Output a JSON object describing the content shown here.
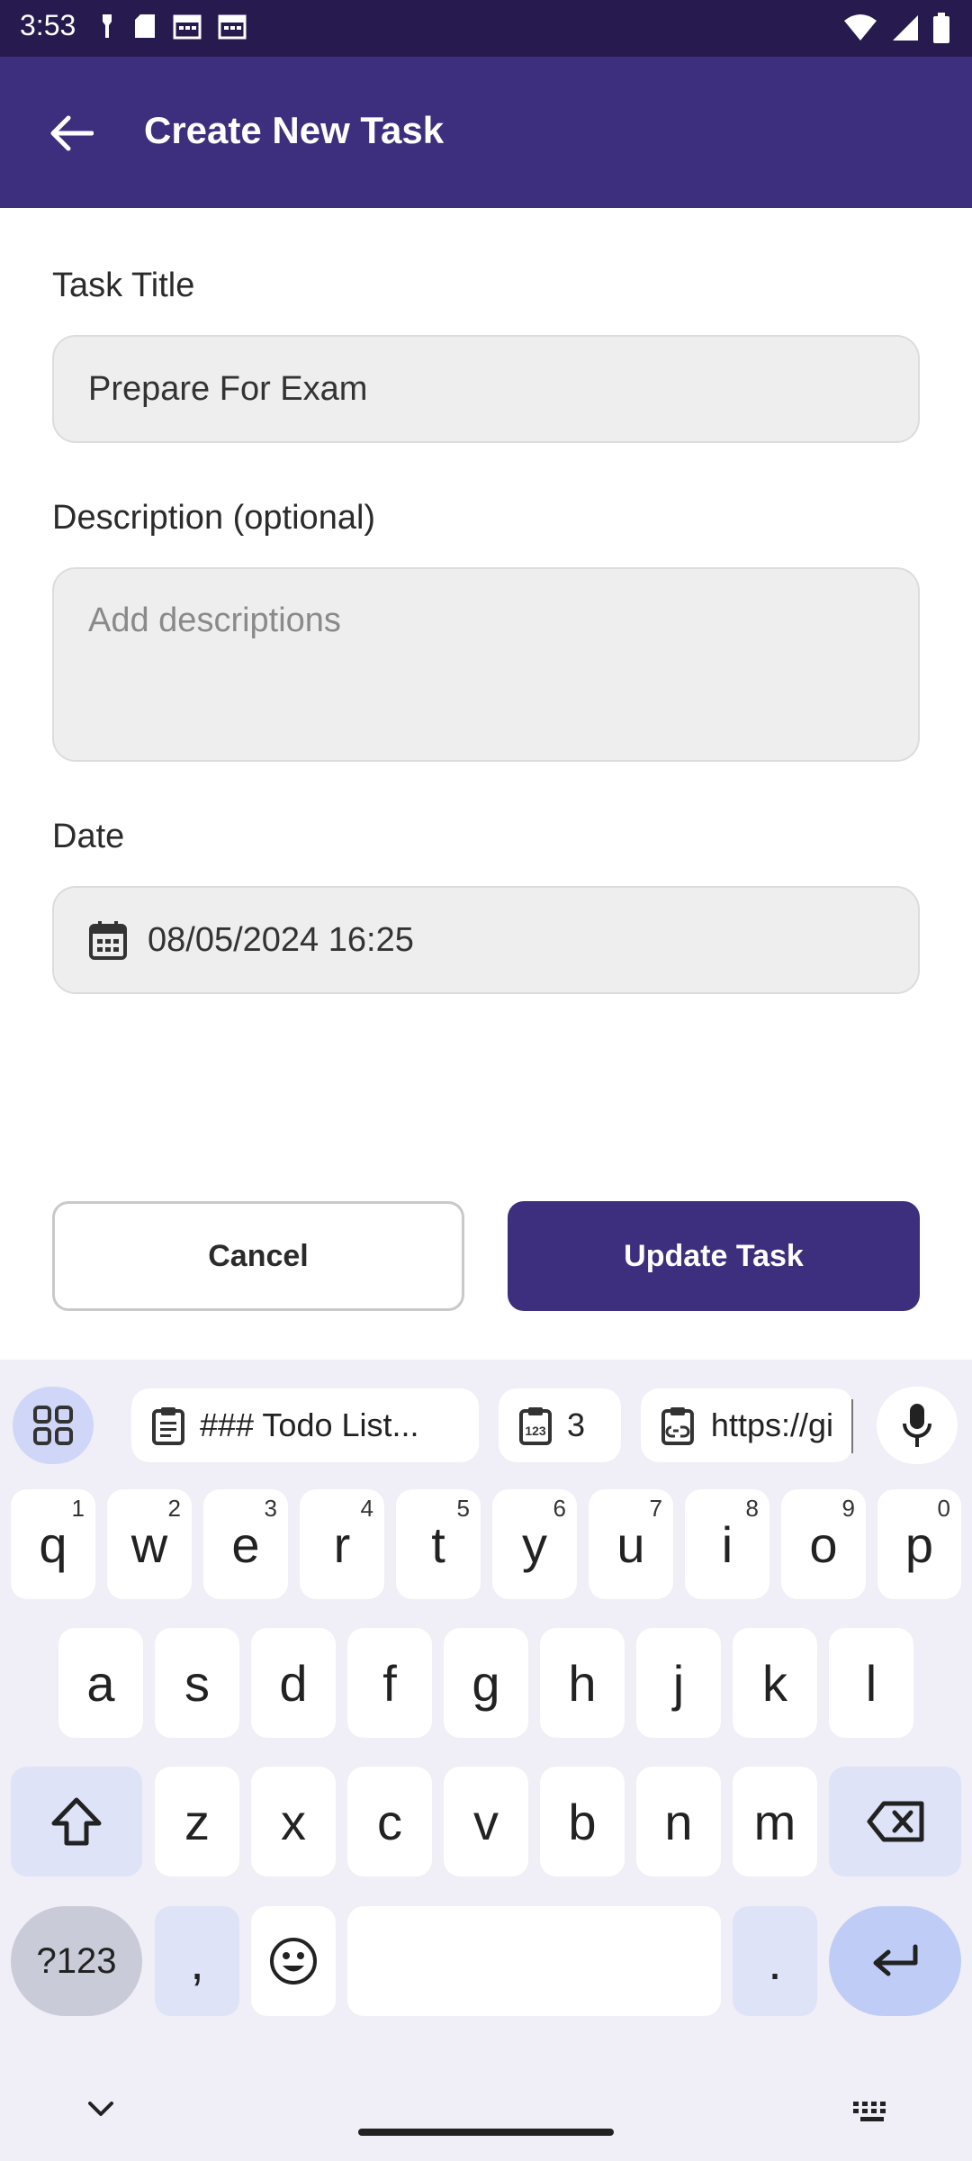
{
  "status_bar": {
    "time": "3:53"
  },
  "app_bar": {
    "title": "Create New Task"
  },
  "form": {
    "title_label": "Task Title",
    "title_value": "Prepare For Exam",
    "description_label": "Description (optional)",
    "description_placeholder": "Add descriptions",
    "date_label": "Date",
    "date_value": "08/05/2024 16:25"
  },
  "buttons": {
    "cancel": "Cancel",
    "update": "Update Task"
  },
  "keyboard": {
    "suggestions": [
      "### Todo List...",
      "3",
      "https://gi"
    ],
    "row1": [
      {
        "k": "q",
        "n": "1"
      },
      {
        "k": "w",
        "n": "2"
      },
      {
        "k": "e",
        "n": "3"
      },
      {
        "k": "r",
        "n": "4"
      },
      {
        "k": "t",
        "n": "5"
      },
      {
        "k": "y",
        "n": "6"
      },
      {
        "k": "u",
        "n": "7"
      },
      {
        "k": "i",
        "n": "8"
      },
      {
        "k": "o",
        "n": "9"
      },
      {
        "k": "p",
        "n": "0"
      }
    ],
    "row2": [
      "a",
      "s",
      "d",
      "f",
      "g",
      "h",
      "j",
      "k",
      "l"
    ],
    "row3": [
      "z",
      "x",
      "c",
      "v",
      "b",
      "n",
      "m"
    ],
    "symbols_key": "?123",
    "comma_key": ",",
    "period_key": "."
  },
  "colors": {
    "primary": "#3d2f7e",
    "status_bar": "#261a4e",
    "field_bg": "#eeeeee",
    "keyboard_bg": "#f0eef6"
  }
}
